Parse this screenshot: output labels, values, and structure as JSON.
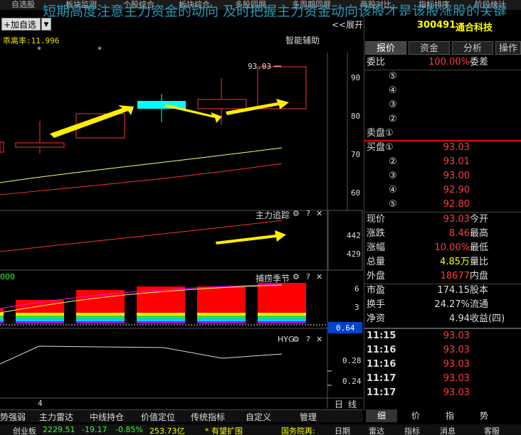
{
  "menu": [
    "自选股",
    "板块监测",
    "个股综合",
    "板块综合",
    "多股同屏",
    "多周期同屏",
    "两股对比",
    "指标排序",
    "阶段统计"
  ],
  "overlay_text": "短期高度注意主力资金的动向 及时把握主力资金动向该股才是该股涨股的关键",
  "toolbar": {
    "add_label": "+加自选",
    "drop": "▼",
    "expand": "<<展开"
  },
  "chart": {
    "bias_label": "乖离率:11.996",
    "assist_label": "智能辅助",
    "price_label": "93.03",
    "y_ticks": [
      "90",
      "80",
      "70",
      "60"
    ]
  },
  "panel2": {
    "title": "主力追踪",
    "y_ticks": [
      "442",
      "429"
    ]
  },
  "panel3": {
    "title": "捕捞季节",
    "prefix": "000",
    "y_ticks": [
      "6",
      "3"
    ],
    "value_box": "0.64"
  },
  "panel4": {
    "title": "HYG",
    "y_ticks": [
      "0.28",
      "0.24"
    ]
  },
  "icons": {
    "gear": "⚙",
    "help": "?",
    "close": "✕"
  },
  "x_tick": "4",
  "period_tabs": [
    "日",
    "线"
  ],
  "stock": {
    "code": "300491",
    "name": "通合科技"
  },
  "tabs": [
    "报价",
    "资金",
    "分析",
    "操作"
  ],
  "commission": {
    "label": "委比",
    "value": "100.00%",
    "label2": "委差"
  },
  "sell": [
    {
      "label": "⑤"
    },
    {
      "label": "④"
    },
    {
      "label": "③"
    },
    {
      "label": "②"
    },
    {
      "label": "卖盘①"
    }
  ],
  "buy": [
    {
      "label": "买盘①",
      "value": "93.03"
    },
    {
      "label": "②",
      "value": "93.01"
    },
    {
      "label": "③",
      "value": "93.00"
    },
    {
      "label": "④",
      "value": "92.90"
    },
    {
      "label": "⑤",
      "value": "92.80"
    }
  ],
  "quote": [
    {
      "l": "现价",
      "v": "93.03",
      "c": "red",
      "l2": "今开"
    },
    {
      "l": "涨跌",
      "v": "8.46",
      "c": "red",
      "l2": "最高"
    },
    {
      "l": "涨幅",
      "v": "10.00%",
      "c": "red",
      "l2": "最低"
    },
    {
      "l": "总量",
      "v": "4.85万",
      "c": "yel",
      "l2": "量比"
    },
    {
      "l": "外盘",
      "v": "18677",
      "c": "red",
      "l2": "内盘"
    }
  ],
  "fund": [
    {
      "l": "市盈",
      "v": "174.15",
      "l2": "股本"
    },
    {
      "l": "换手",
      "v": "24.27%",
      "l2": "流通"
    },
    {
      "l": "净资",
      "v": "4.94",
      "l2": "收益(四)"
    }
  ],
  "ticks": [
    {
      "t": "11:15",
      "p": "93.03"
    },
    {
      "t": "11:16",
      "p": "93.03"
    },
    {
      "t": "11:16",
      "p": "93.03"
    },
    {
      "t": "11:17",
      "p": "93.03"
    },
    {
      "t": "11:17",
      "p": "93.03"
    }
  ],
  "bottom_tabs": [
    "势强弱",
    "主力雷达",
    "中线持仓",
    "价值定位",
    "传统指标",
    "自定义",
    "管理"
  ],
  "right_bottom_tabs": [
    "细",
    "价",
    "指",
    "势"
  ],
  "status": {
    "index": "创业板",
    "idx_val": "2229.51",
    "idx_chg": "-19.17",
    "idx_pct": "-0.85%",
    "idx_amt": "253.73亿",
    "news": "* 有望扩围",
    "item1": "国务院再:",
    "item2": "日期",
    "item3": "雷达",
    "item4": "指标",
    "item5": "消息",
    "item6": "客服"
  }
}
